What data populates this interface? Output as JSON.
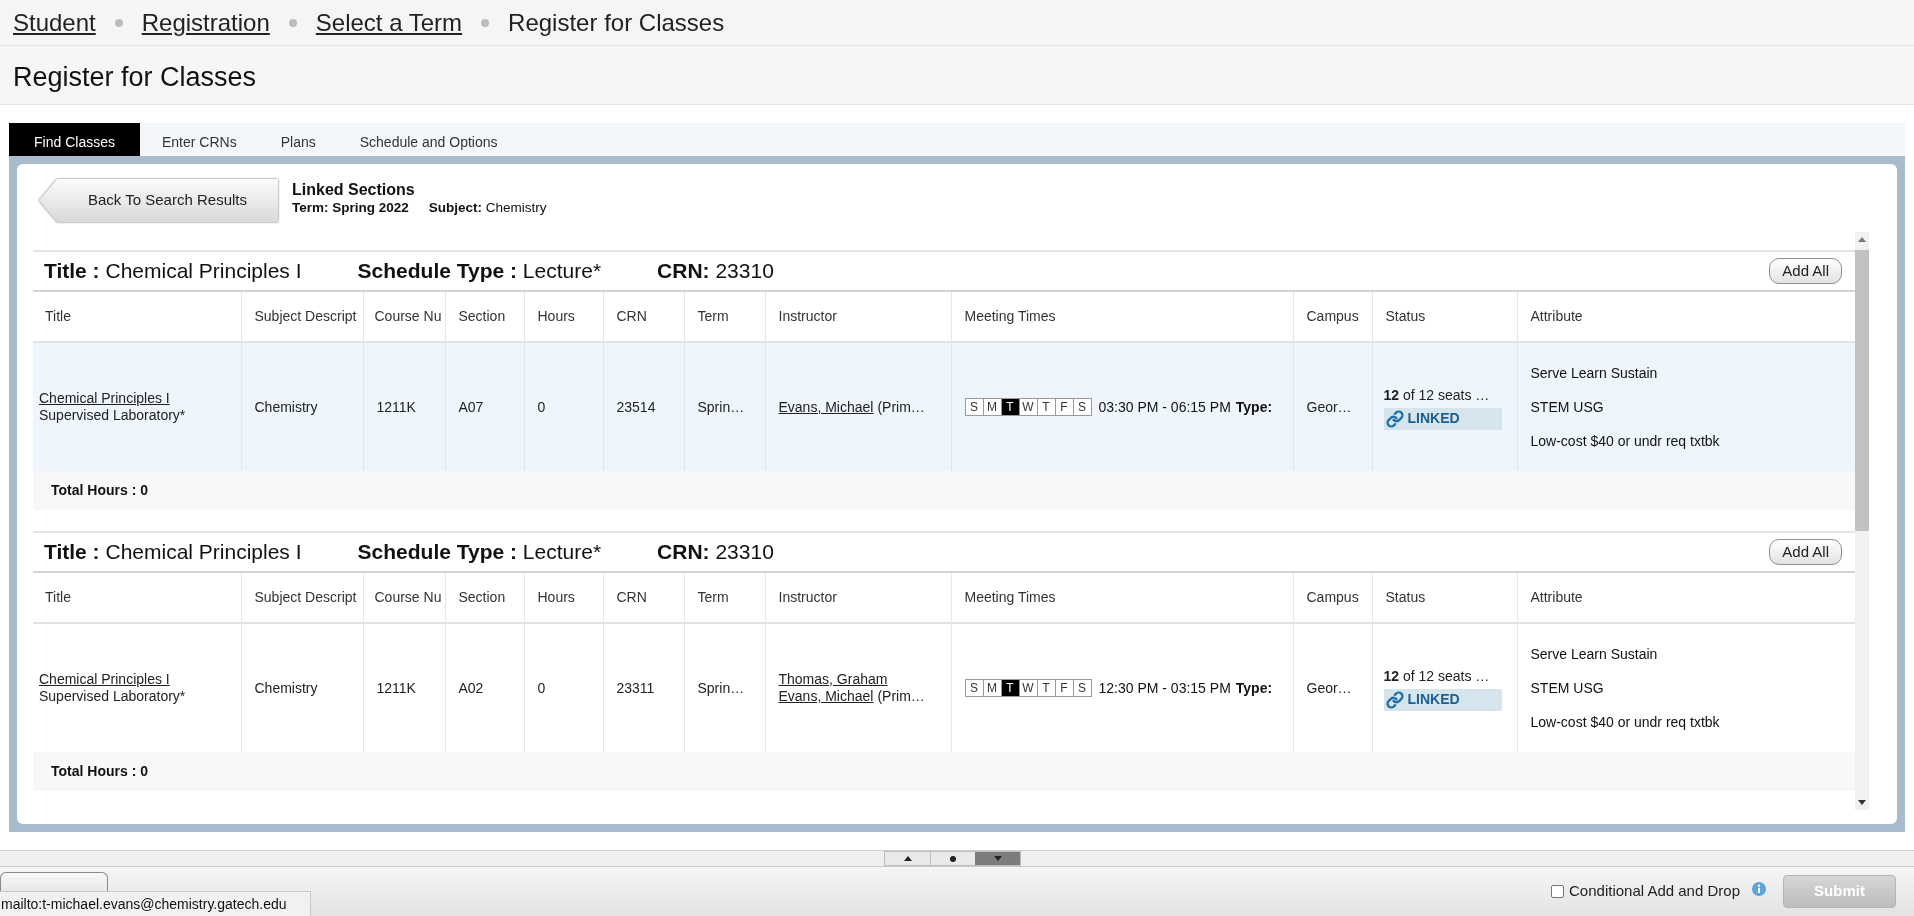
{
  "breadcrumb": [
    {
      "label": "Student",
      "current": false
    },
    {
      "label": "Registration",
      "current": false
    },
    {
      "label": "Select a Term",
      "current": false
    },
    {
      "label": "Register for Classes",
      "current": true
    }
  ],
  "page_title": "Register for Classes",
  "tabs": [
    {
      "label": "Find Classes",
      "selected": true
    },
    {
      "label": "Enter CRNs",
      "selected": false
    },
    {
      "label": "Plans",
      "selected": false
    },
    {
      "label": "Schedule and Options",
      "selected": false
    }
  ],
  "back_button": "Back To Search Results",
  "linked_sections": {
    "heading": "Linked Sections",
    "term": "Term: Spring 2022",
    "subject": "**Subject:** Chemistry"
  },
  "sections": [
    {
      "header": [
        "**Title :** Chemical Principles I",
        "**Schedule Type :** Lecture*",
        "**CRN:** 23310"
      ],
      "add_all": "Add All",
      "columns": [
        "Title",
        "Subject Descript",
        "Course Nu",
        "Section",
        "Hours",
        "CRN",
        "Term",
        "Instructor",
        "Meeting Times",
        "Campus",
        "Status",
        "Attribute"
      ],
      "rows": [
        {
          "highlighted": true,
          "title": "Chemical Principles I",
          "title_note": "Supervised Laboratory*",
          "subject": "Chemistry",
          "course": "1211K",
          "section": "A07",
          "hours": "0",
          "crn": "23514",
          "term": "Sprin…",
          "instructors": [
            {
              "name": "Evans, Michael",
              "role": "(Prim…"
            }
          ],
          "days": [
            {
              "label": "S",
              "active": false
            },
            {
              "label": "M",
              "active": false
            },
            {
              "label": "T",
              "active": true
            },
            {
              "label": "W",
              "active": false
            },
            {
              "label": "T",
              "active": false
            },
            {
              "label": "F",
              "active": false
            },
            {
              "label": "S",
              "active": false
            }
          ],
          "time": "03:30 PM - 06:15 PM",
          "type_label": "Type:",
          "campus": "Geor…",
          "seats": "**12** of 12 seats …",
          "status": "LINKED",
          "attributes": [
            "Serve Learn Sustain",
            "STEM USG",
            "Low-cost $40 or undr req txtbk"
          ]
        }
      ],
      "total_hours": "Total Hours : 0"
    },
    {
      "header": [
        "**Title :** Chemical Principles I",
        "**Schedule Type :** Lecture*",
        "**CRN:** 23310"
      ],
      "add_all": "Add All",
      "columns": [
        "Title",
        "Subject Descript",
        "Course Nu",
        "Section",
        "Hours",
        "CRN",
        "Term",
        "Instructor",
        "Meeting Times",
        "Campus",
        "Status",
        "Attribute"
      ],
      "rows": [
        {
          "highlighted": false,
          "title": "Chemical Principles I",
          "title_note": "Supervised Laboratory*",
          "subject": "Chemistry",
          "course": "1211K",
          "section": "A02",
          "hours": "0",
          "crn": "23311",
          "term": "Sprin…",
          "instructors": [
            {
              "name": "Thomas, Graham"
            },
            {
              "name": "Evans, Michael",
              "role": "(Prim…"
            }
          ],
          "days": [
            {
              "label": "S",
              "active": false
            },
            {
              "label": "M",
              "active": false
            },
            {
              "label": "T",
              "active": true
            },
            {
              "label": "W",
              "active": false
            },
            {
              "label": "T",
              "active": false
            },
            {
              "label": "F",
              "active": false
            },
            {
              "label": "S",
              "active": false
            }
          ],
          "time": "12:30 PM - 03:15 PM",
          "type_label": "Type:",
          "campus": "Geor…",
          "seats": "**12** of 12 seats …",
          "status": "LINKED",
          "attributes": [
            "Serve Learn Sustain",
            "STEM USG",
            "Low-cost $40 or undr req txtbk"
          ]
        }
      ],
      "total_hours": "Total Hours : 0"
    }
  ],
  "footer": {
    "conditional": {
      "label": "Conditional Add and Drop",
      "checked": false
    },
    "submit": {
      "label": "Submit",
      "disabled": true
    }
  },
  "status_link": "mailto:t-michael.evans@chemistry.gatech.edu"
}
